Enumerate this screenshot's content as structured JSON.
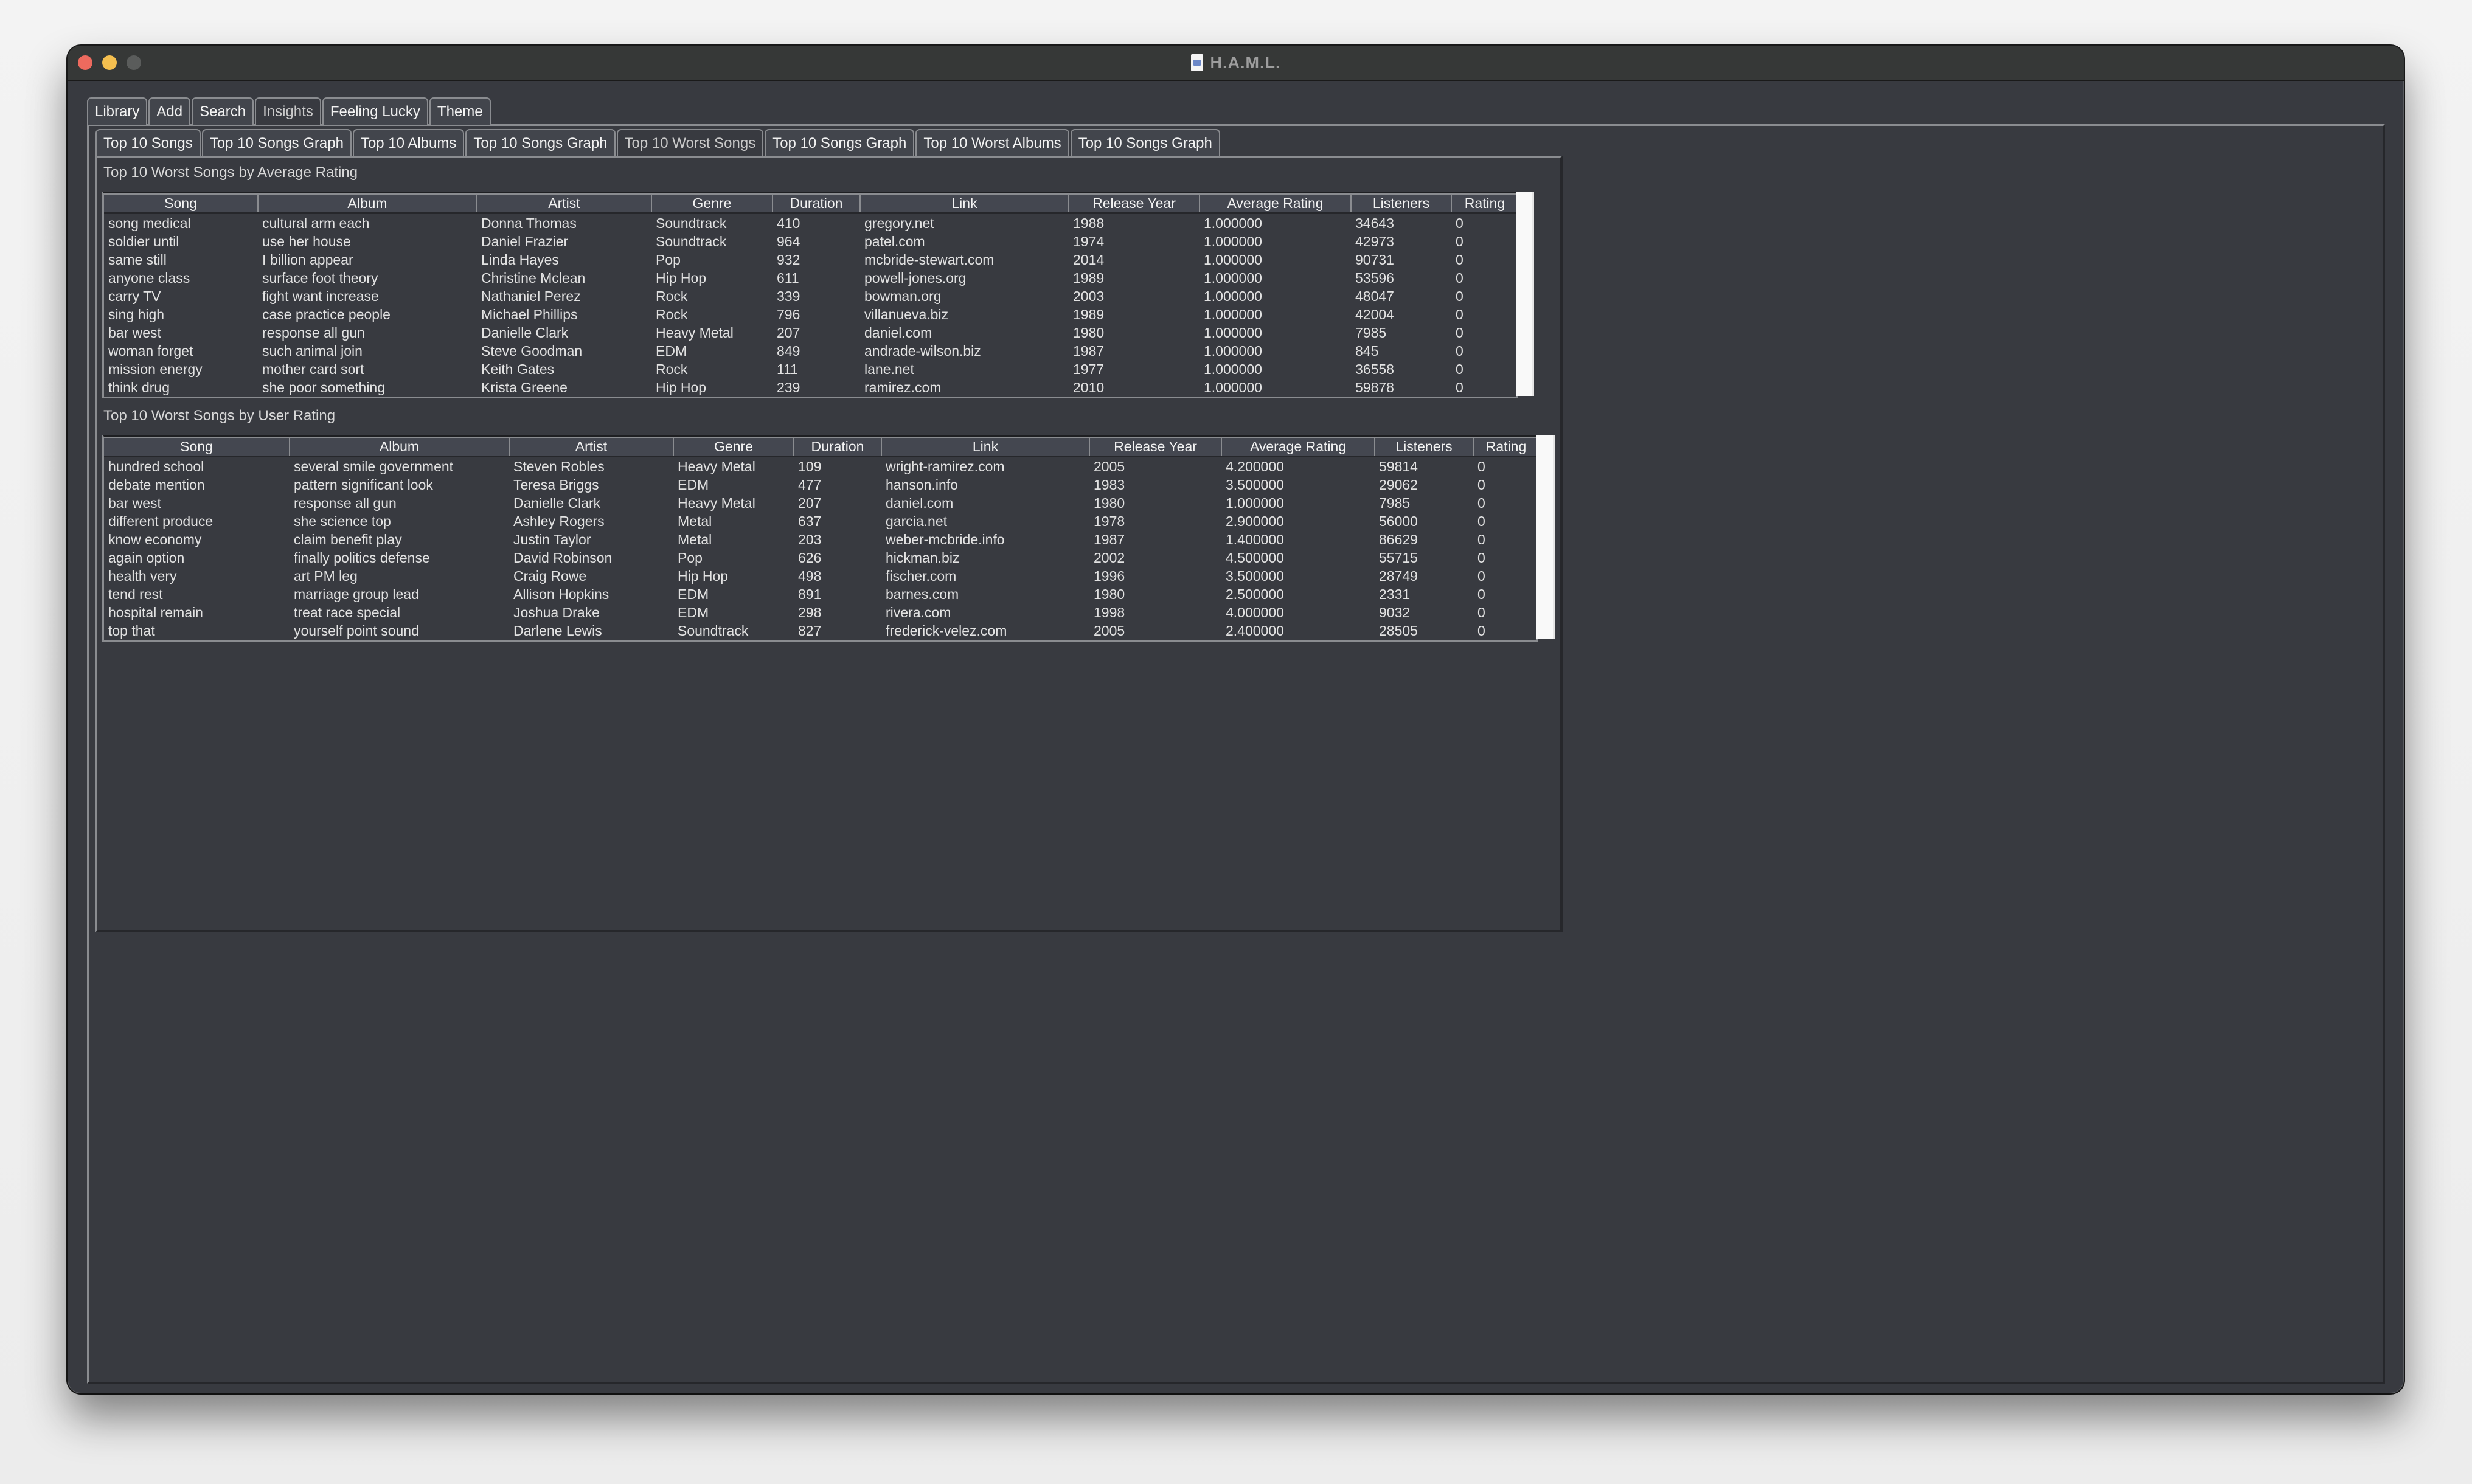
{
  "window": {
    "title": "H.A.M.L.",
    "title_icon": "document-icon",
    "traffic_lights": {
      "close": "#ed6a5e",
      "minimize": "#f5bf4f",
      "zoom": "#5a5c5b"
    }
  },
  "outer_tabs": [
    {
      "label": "Library",
      "selected": false
    },
    {
      "label": "Add",
      "selected": false
    },
    {
      "label": "Search",
      "selected": false
    },
    {
      "label": "Insights",
      "selected": true
    },
    {
      "label": "Feeling Lucky",
      "selected": false
    },
    {
      "label": "Theme",
      "selected": false
    }
  ],
  "inner_tabs": [
    {
      "label": "Top 10 Songs",
      "selected": false
    },
    {
      "label": "Top 10 Songs Graph",
      "selected": false
    },
    {
      "label": "Top 10 Albums",
      "selected": false
    },
    {
      "label": "Top 10 Songs Graph",
      "selected": false
    },
    {
      "label": "Top 10 Worst Songs",
      "selected": true
    },
    {
      "label": "Top 10 Songs Graph",
      "selected": false
    },
    {
      "label": "Top 10 Worst Albums",
      "selected": false
    },
    {
      "label": "Top 10 Songs Graph",
      "selected": false
    }
  ],
  "columns": [
    "Song",
    "Album",
    "Artist",
    "Genre",
    "Duration",
    "Link",
    "Release Year",
    "Average Rating",
    "Listeners",
    "Rating"
  ],
  "tables": [
    {
      "title": "Top 10 Worst Songs by Average Rating",
      "rows": [
        [
          "song medical",
          "cultural arm each",
          "Donna Thomas",
          "Soundtrack",
          "410",
          "gregory.net",
          "1988",
          "1.000000",
          "34643",
          "0"
        ],
        [
          "soldier until",
          "use her house",
          "Daniel Frazier",
          "Soundtrack",
          "964",
          "patel.com",
          "1974",
          "1.000000",
          "42973",
          "0"
        ],
        [
          "same still",
          "I billion appear",
          "Linda Hayes",
          "Pop",
          "932",
          "mcbride-stewart.com",
          "2014",
          "1.000000",
          "90731",
          "0"
        ],
        [
          "anyone class",
          "surface foot theory",
          "Christine Mclean",
          "Hip Hop",
          "611",
          "powell-jones.org",
          "1989",
          "1.000000",
          "53596",
          "0"
        ],
        [
          "carry TV",
          "fight want increase",
          "Nathaniel Perez",
          "Rock",
          "339",
          "bowman.org",
          "2003",
          "1.000000",
          "48047",
          "0"
        ],
        [
          "sing high",
          "case practice people",
          "Michael Phillips",
          "Rock",
          "796",
          "villanueva.biz",
          "1989",
          "1.000000",
          "42004",
          "0"
        ],
        [
          "bar west",
          "response all gun",
          "Danielle Clark",
          "Heavy Metal",
          "207",
          "daniel.com",
          "1980",
          "1.000000",
          "7985",
          "0"
        ],
        [
          "woman forget",
          "such animal join",
          "Steve Goodman",
          "EDM",
          "849",
          "andrade-wilson.biz",
          "1987",
          "1.000000",
          "845",
          "0"
        ],
        [
          "mission energy",
          "mother card sort",
          "Keith Gates",
          "Rock",
          "111",
          "lane.net",
          "1977",
          "1.000000",
          "36558",
          "0"
        ],
        [
          "think drug",
          "she poor something",
          "Krista Greene",
          "Hip Hop",
          "239",
          "ramirez.com",
          "2010",
          "1.000000",
          "59878",
          "0"
        ]
      ]
    },
    {
      "title": "Top 10 Worst Songs by User Rating",
      "rows": [
        [
          "hundred school",
          "several smile government",
          "Steven Robles",
          "Heavy Metal",
          "109",
          "wright-ramirez.com",
          "2005",
          "4.200000",
          "59814",
          "0"
        ],
        [
          "debate mention",
          "pattern significant look",
          "Teresa Briggs",
          "EDM",
          "477",
          "hanson.info",
          "1983",
          "3.500000",
          "29062",
          "0"
        ],
        [
          "bar west",
          "response all gun",
          "Danielle Clark",
          "Heavy Metal",
          "207",
          "daniel.com",
          "1980",
          "1.000000",
          "7985",
          "0"
        ],
        [
          "different produce",
          "she science top",
          "Ashley Rogers",
          "Metal",
          "637",
          "garcia.net",
          "1978",
          "2.900000",
          "56000",
          "0"
        ],
        [
          "know economy",
          "claim benefit play",
          "Justin Taylor",
          "Metal",
          "203",
          "weber-mcbride.info",
          "1987",
          "1.400000",
          "86629",
          "0"
        ],
        [
          "again option",
          "finally politics defense",
          "David Robinson",
          "Pop",
          "626",
          "hickman.biz",
          "2002",
          "4.500000",
          "55715",
          "0"
        ],
        [
          "health very",
          "art PM leg",
          "Craig Rowe",
          "Hip Hop",
          "498",
          "fischer.com",
          "1996",
          "3.500000",
          "28749",
          "0"
        ],
        [
          "tend rest",
          "marriage group lead",
          "Allison Hopkins",
          "EDM",
          "891",
          "barnes.com",
          "1980",
          "2.500000",
          "2331",
          "0"
        ],
        [
          "hospital remain",
          "treat race special",
          "Joshua Drake",
          "EDM",
          "298",
          "rivera.com",
          "1998",
          "4.000000",
          "9032",
          "0"
        ],
        [
          "top that",
          "yourself point sound",
          "Darlene Lewis",
          "Soundtrack",
          "827",
          "frederick-velez.com",
          "2005",
          "2.400000",
          "28505",
          "0"
        ]
      ]
    }
  ]
}
